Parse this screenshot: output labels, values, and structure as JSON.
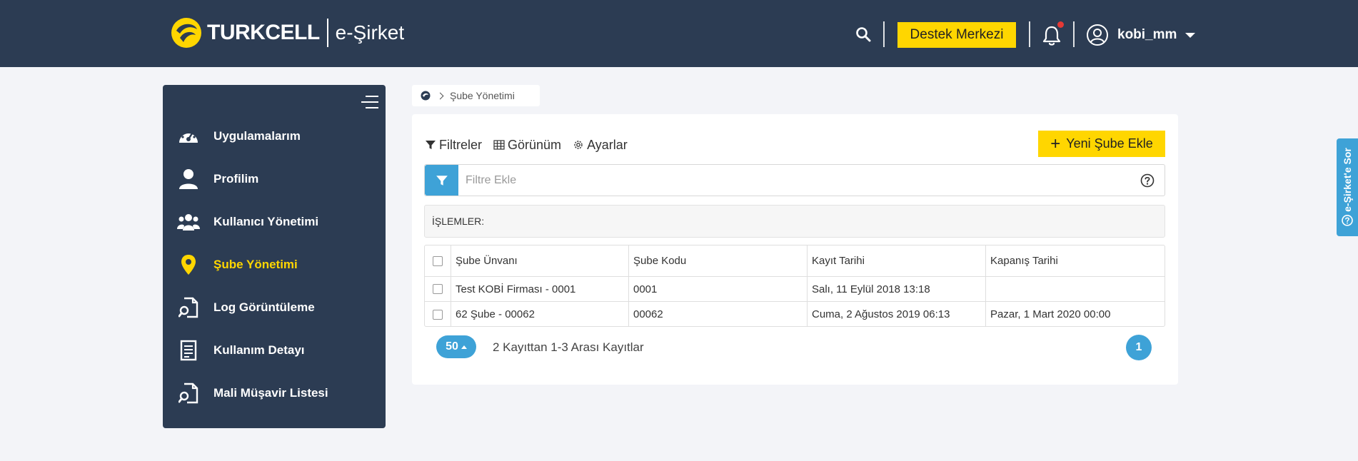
{
  "header": {
    "brand": "TURKCELL",
    "product": "e-Şirket",
    "support_label": "Destek Merkezi",
    "username": "kobi_mm",
    "colors": {
      "bar": "#2c3c53",
      "accent": "#ffd600",
      "notification": "#e53935"
    }
  },
  "sidebar": {
    "items": [
      {
        "label": "Uygulamalarım",
        "icon": "dashboard-icon"
      },
      {
        "label": "Profilim",
        "icon": "user-icon"
      },
      {
        "label": "Kullanıcı Yönetimi",
        "icon": "users-icon"
      },
      {
        "label": "Şube Yönetimi",
        "icon": "location-pin-icon",
        "active": true
      },
      {
        "label": "Log Görüntüleme",
        "icon": "log-search-icon"
      },
      {
        "label": "Kullanım Detayı",
        "icon": "document-icon"
      },
      {
        "label": "Mali Müşavir Listesi",
        "icon": "list-search-icon"
      }
    ]
  },
  "breadcrumb": {
    "current": "Şube Yönetimi"
  },
  "toolbar": {
    "filters": "Filtreler",
    "view": "Görünüm",
    "settings": "Ayarlar",
    "new_branch": "Yeni Şube Ekle"
  },
  "filter": {
    "placeholder": "Filtre Ekle"
  },
  "operations_label": "İŞLEMLER:",
  "table": {
    "columns": [
      "Şube Ünvanı",
      "Şube Kodu",
      "Kayıt Tarihi",
      "Kapanış Tarihi"
    ],
    "rows": [
      [
        "Test KOBİ Firması - 0001",
        "0001",
        "Salı, 11 Eylül 2018 13:18",
        ""
      ],
      [
        "62 Şube - 00062",
        "00062",
        "Cuma, 2 Ağustos 2019 06:13",
        "Pazar, 1 Mart 2020 00:00"
      ]
    ]
  },
  "pagination": {
    "page_size": "50",
    "record_info": "2 Kayıttan 1-3 Arası Kayıtlar",
    "current_page": "1"
  },
  "side_tab": {
    "label": "e-Şirket'e Sor"
  }
}
